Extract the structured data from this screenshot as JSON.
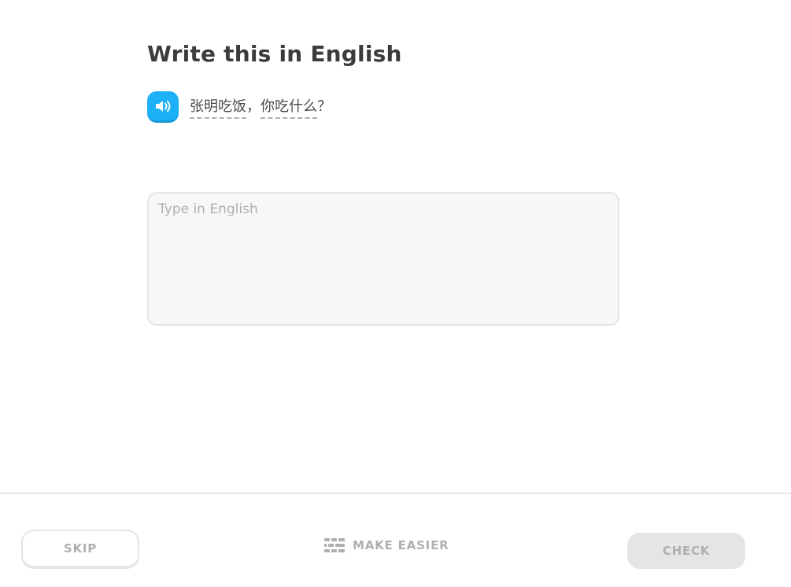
{
  "challenge": {
    "title": "Write this in English"
  },
  "prompt": {
    "audio_icon": "speaker-icon",
    "words": [
      "张明吃饭",
      "你吃什么"
    ],
    "punctuation": [
      "，",
      "？"
    ]
  },
  "answer": {
    "value": "",
    "placeholder": "Type in English"
  },
  "footer": {
    "skip_label": "SKIP",
    "make_easier_label": "MAKE EASIER",
    "make_easier_icon": "bricks-icon",
    "check_label": "CHECK"
  },
  "colors": {
    "accent_blue": "#1cb0f6",
    "disabled_gray": "#e5e5e5",
    "muted_text": "#afafaf",
    "title_text": "#3c3c3c"
  }
}
